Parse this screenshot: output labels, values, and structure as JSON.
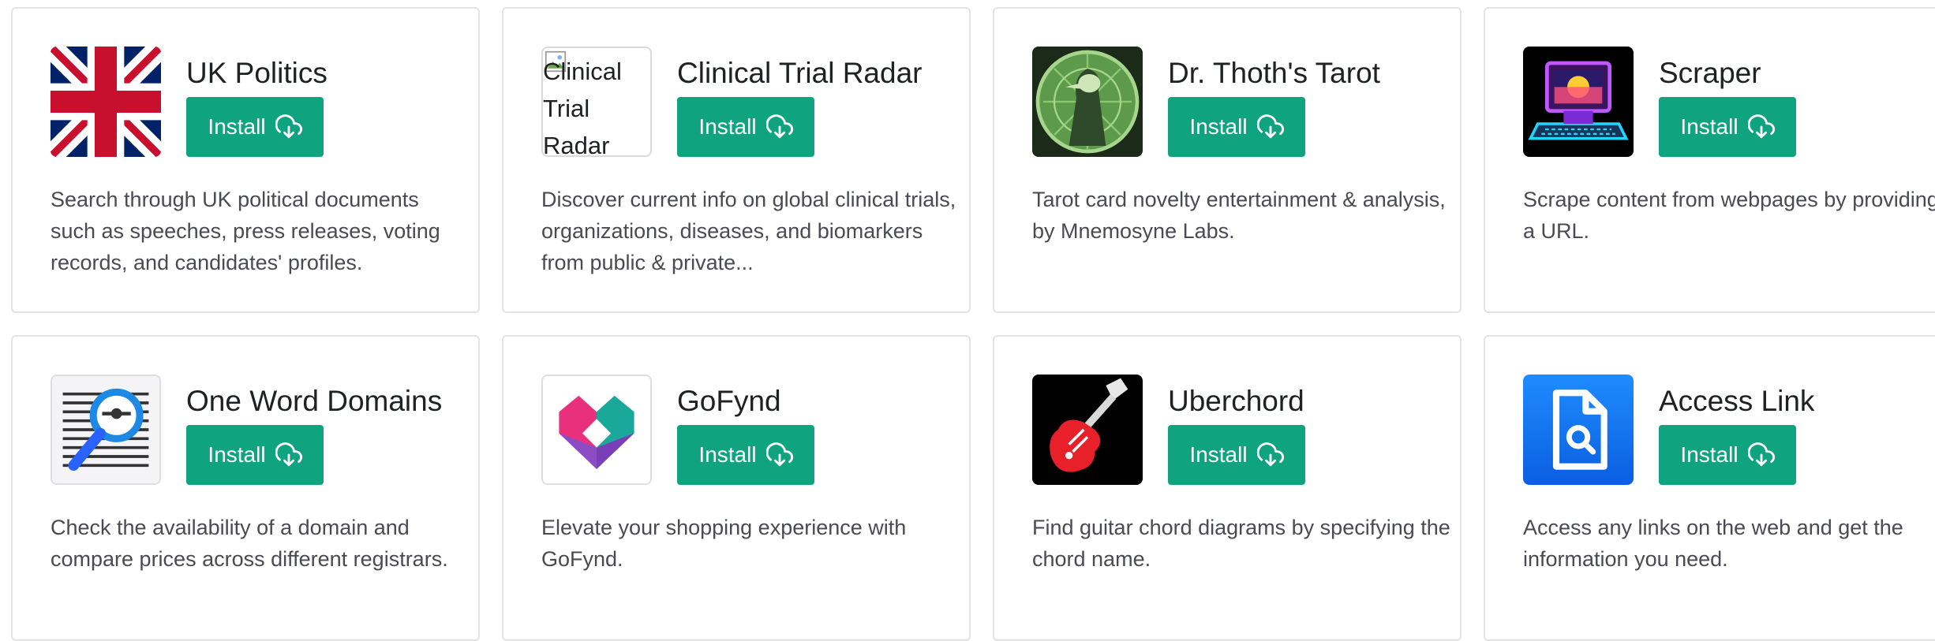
{
  "install_label": "Install",
  "colors": {
    "install_bg": "#10a37f",
    "card_border": "#e3e3e6"
  },
  "plugins": [
    {
      "title": "UK Politics",
      "icon": "union-jack-flag-icon",
      "description": "Search through UK political documents such as speeches, press releases, voting records, and candidates' profiles."
    },
    {
      "title": "Clinical Trial Radar",
      "icon": "broken-image-icon",
      "icon_alt": "Clinical Trial Radar",
      "description": "Discover current info on global clinical trials, organizations, diseases, and biomarkers from public & private..."
    },
    {
      "title": "Dr. Thoth's Tarot",
      "icon": "tarot-figure-icon",
      "description": "Tarot card novelty entertainment & analysis, by Mnemosyne Labs."
    },
    {
      "title": "Scraper",
      "icon": "retro-computer-icon",
      "description": "Scrape content from webpages by providing a URL."
    },
    {
      "title": "One Word Domains",
      "icon": "magnifier-document-icon",
      "description": "Check the availability of a domain and compare prices across different registrars."
    },
    {
      "title": "GoFynd",
      "icon": "heart-logo-icon",
      "description": "Elevate your shopping experience with GoFynd."
    },
    {
      "title": "Uberchord",
      "icon": "electric-guitar-icon",
      "description": "Find guitar chord diagrams by specifying the chord name."
    },
    {
      "title": "Access Link",
      "icon": "search-document-icon",
      "description": "Access any links on the web and get the information you need."
    }
  ]
}
